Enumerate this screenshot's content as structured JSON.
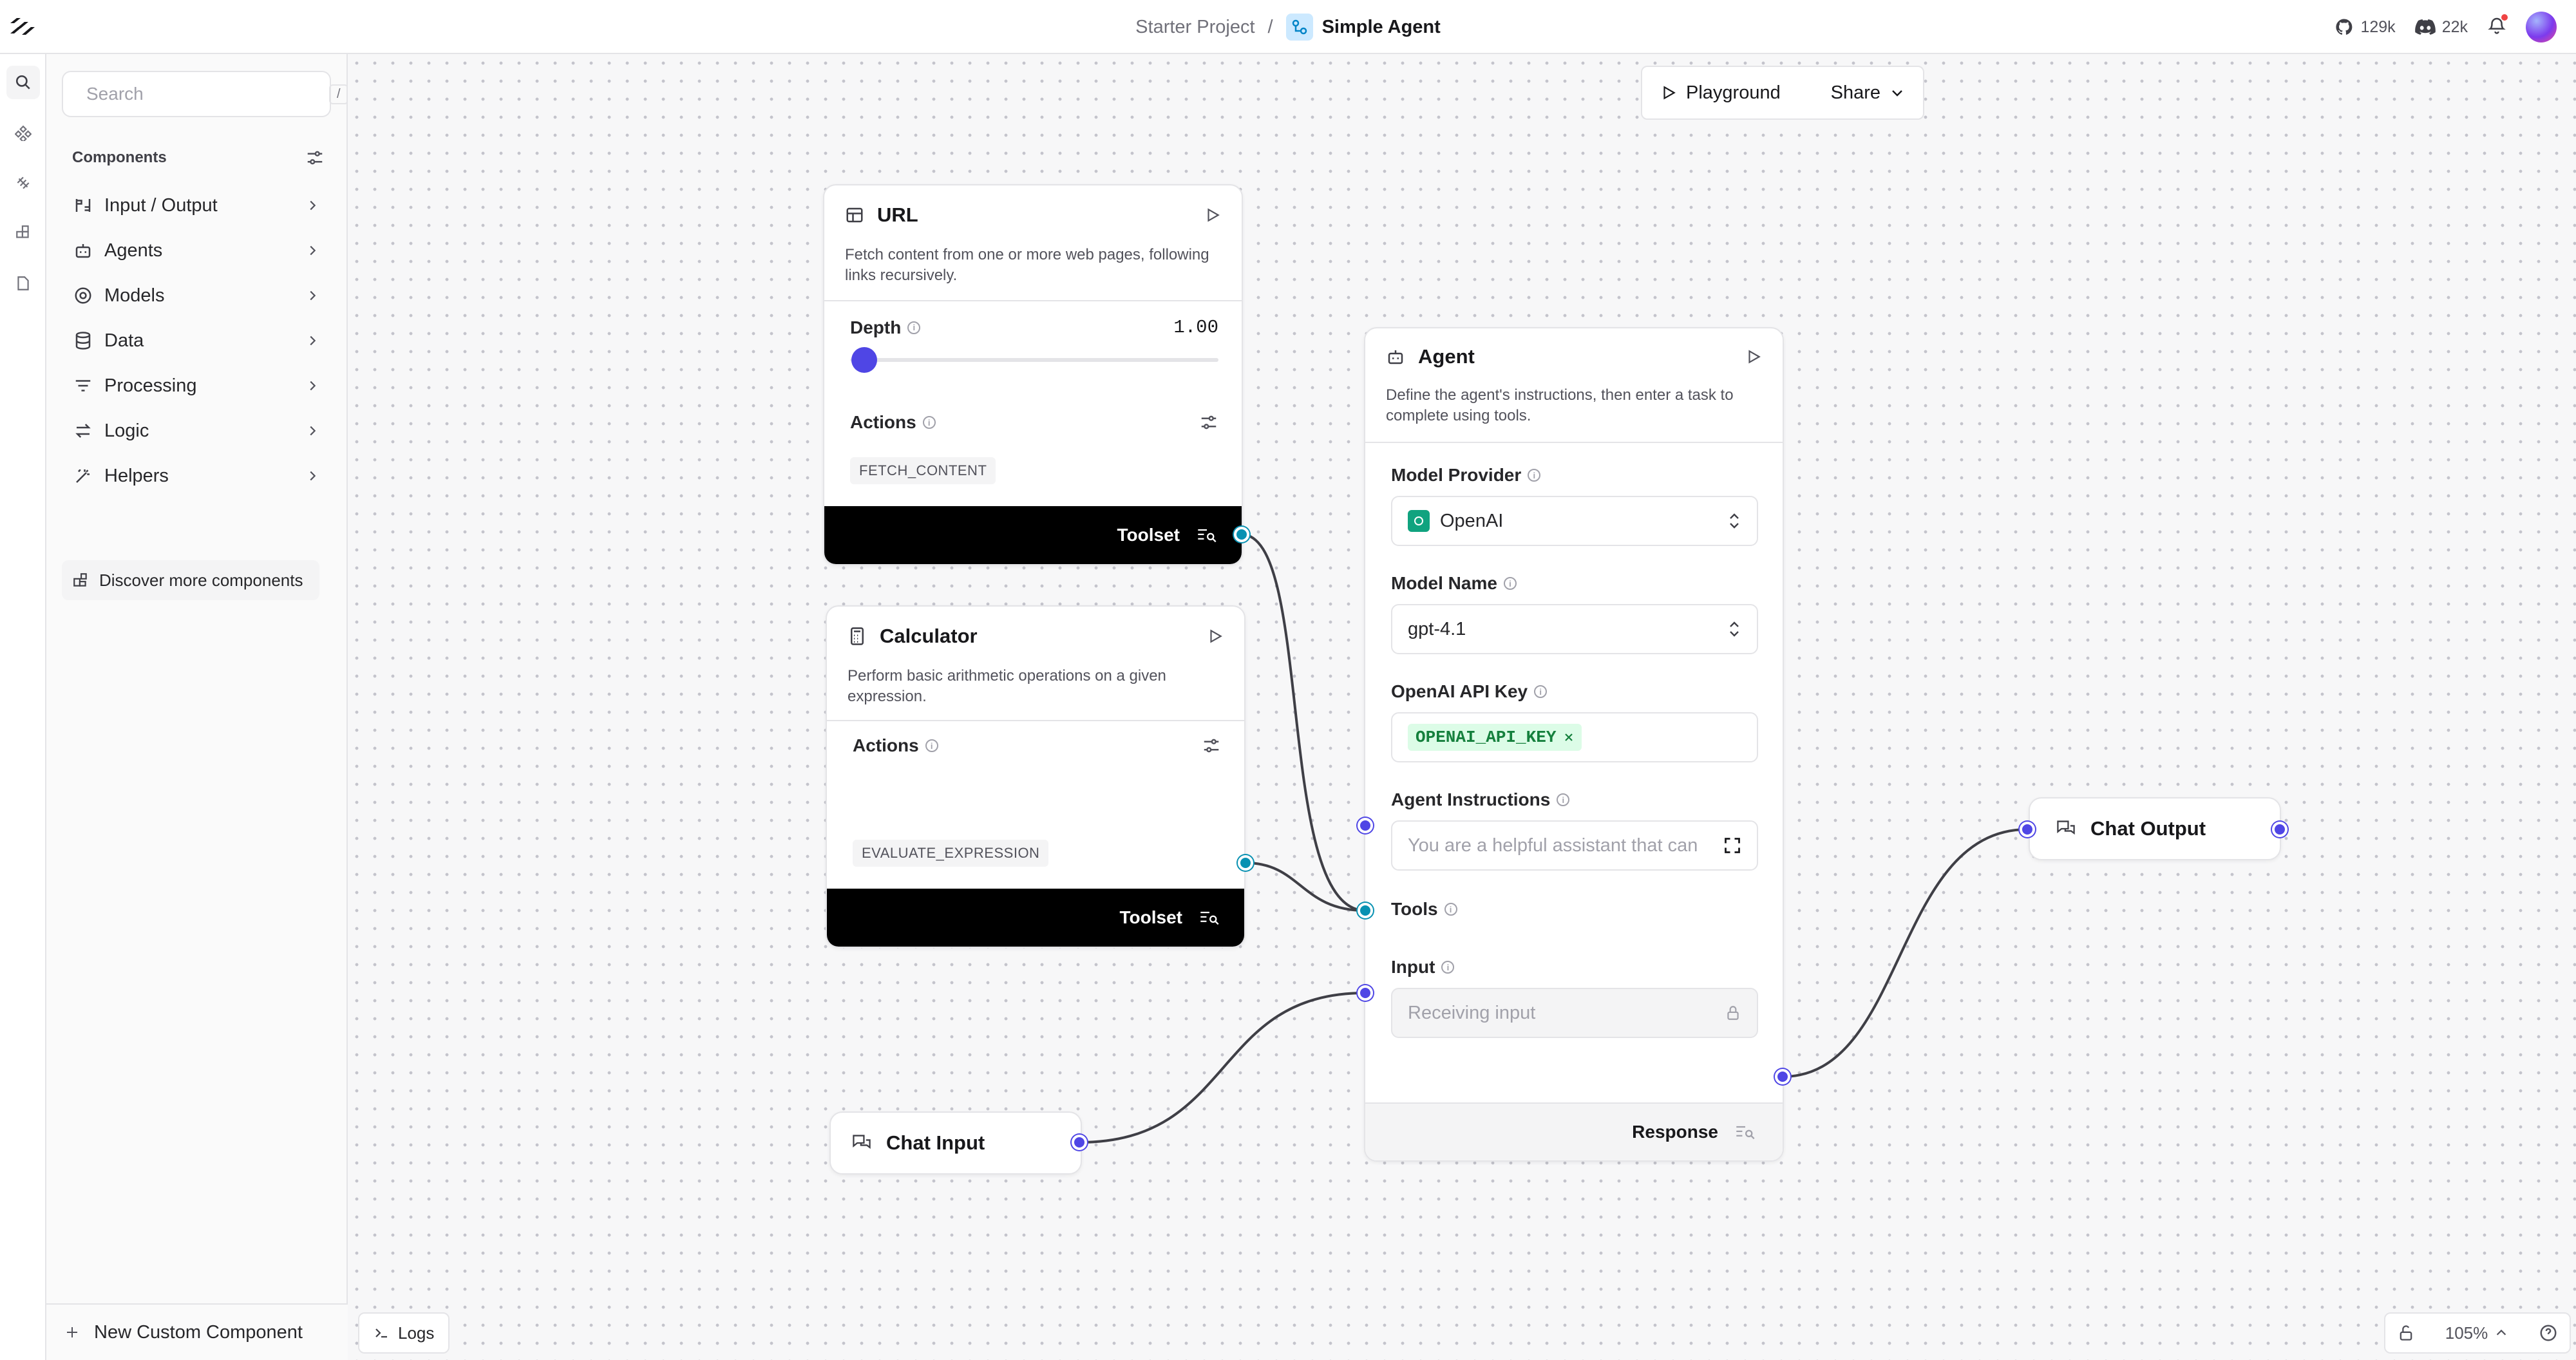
{
  "header": {
    "breadcrumb_parent": "Starter Project",
    "breadcrumb_separator": "/",
    "flow_name": "Simple Agent",
    "github_stars": "129k",
    "discord_members": "22k"
  },
  "sidebar": {
    "search_placeholder": "Search",
    "search_shortcut": "/",
    "components_heading": "Components",
    "categories": [
      {
        "label": "Input / Output",
        "icon": "input-output-icon"
      },
      {
        "label": "Agents",
        "icon": "bot-icon"
      },
      {
        "label": "Models",
        "icon": "model-icon"
      },
      {
        "label": "Data",
        "icon": "database-icon"
      },
      {
        "label": "Processing",
        "icon": "filter-icon"
      },
      {
        "label": "Logic",
        "icon": "arrows-icon"
      },
      {
        "label": "Helpers",
        "icon": "wand-icon"
      }
    ],
    "discover_label": "Discover more components",
    "new_custom_label": "New Custom Component"
  },
  "toolbar": {
    "playground_label": "Playground",
    "share_label": "Share"
  },
  "nodes": {
    "url": {
      "title": "URL",
      "description": "Fetch content from one or more web pages, following links recursively.",
      "depth_label": "Depth",
      "depth_value": "1.00",
      "depth_level": 0.0,
      "actions_label": "Actions",
      "action_chip": "FETCH_CONTENT",
      "toolset_label": "Toolset"
    },
    "calculator": {
      "title": "Calculator",
      "description": "Perform basic arithmetic operations on a given expression.",
      "actions_label": "Actions",
      "action_chip": "EVALUATE_EXPRESSION",
      "toolset_label": "Toolset"
    },
    "agent": {
      "title": "Agent",
      "description": "Define the agent's instructions, then enter a task to complete using tools.",
      "model_provider_label": "Model Provider",
      "model_provider_value": "OpenAI",
      "model_name_label": "Model Name",
      "model_name_value": "gpt-4.1",
      "api_key_label": "OpenAI API Key",
      "api_key_value": "OPENAI_API_KEY",
      "instructions_label": "Agent Instructions",
      "instructions_value": "You are a helpful assistant that can",
      "tools_label": "Tools",
      "input_label": "Input",
      "input_placeholder": "Receiving input",
      "response_label": "Response"
    },
    "chat_input": {
      "title": "Chat Input"
    },
    "chat_output": {
      "title": "Chat Output"
    }
  },
  "footer": {
    "logs_label": "Logs",
    "zoom": "105%"
  },
  "colors": {
    "accent": "#4f46e5",
    "tool_handle": "#0891b2",
    "api_key_chip_bg": "#dcfce7",
    "api_key_chip_text": "#15803d",
    "openai_badge": "#10a37f"
  }
}
